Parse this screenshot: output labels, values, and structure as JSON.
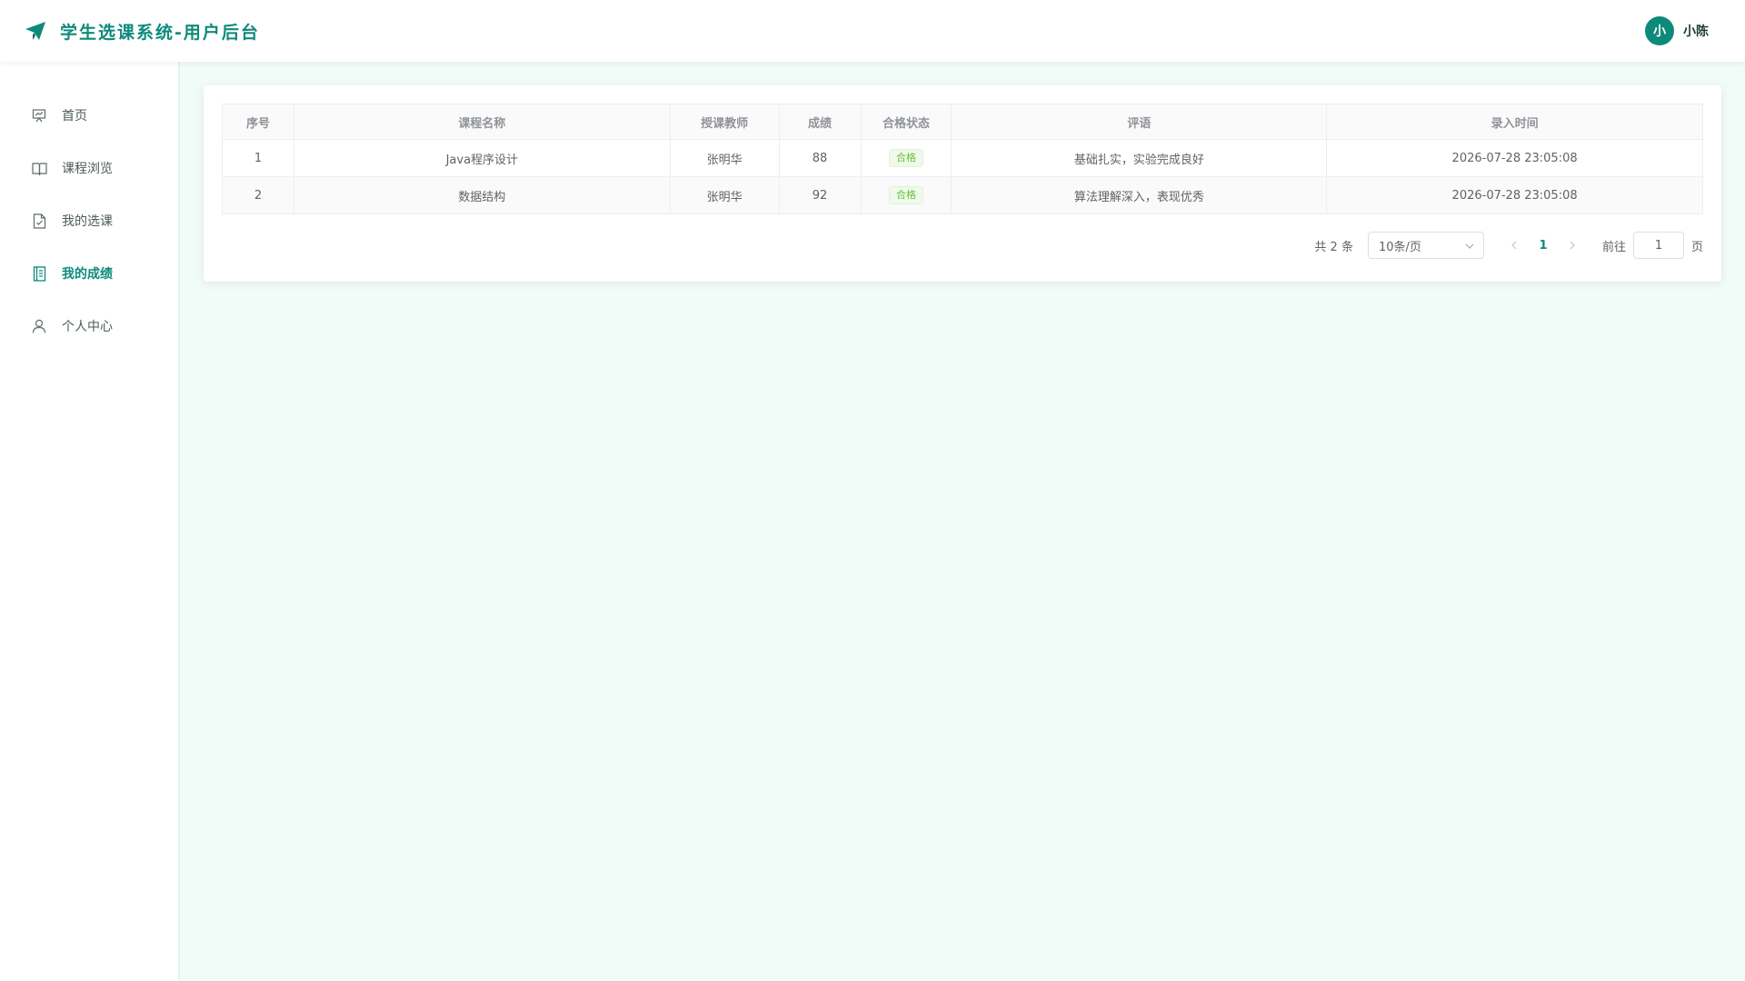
{
  "header": {
    "title": "学生选课系统-用户后台",
    "logo_icon": "paper-plane-icon",
    "user": {
      "avatar_text": "小",
      "name": "小陈"
    }
  },
  "sidebar": {
    "items": [
      {
        "label": "首页",
        "icon": "presentation-board-icon",
        "active": false
      },
      {
        "label": "课程浏览",
        "icon": "open-book-icon",
        "active": false
      },
      {
        "label": "我的选课",
        "icon": "document-check-icon",
        "active": false
      },
      {
        "label": "我的成绩",
        "icon": "notebook-icon",
        "active": true
      },
      {
        "label": "个人中心",
        "icon": "user-icon",
        "active": false
      }
    ]
  },
  "table": {
    "columns": [
      "序号",
      "课程名称",
      "授课教师",
      "成绩",
      "合格状态",
      "评语",
      "录入时间"
    ],
    "rows": [
      {
        "index": "1",
        "course": "Java程序设计",
        "teacher": "张明华",
        "score": "88",
        "status": "合格",
        "comment": "基础扎实，实验完成良好",
        "time": "2026-07-28 23:05:08"
      },
      {
        "index": "2",
        "course": "数据结构",
        "teacher": "张明华",
        "score": "92",
        "status": "合格",
        "comment": "算法理解深入，表现优秀",
        "time": "2026-07-28 23:05:08"
      }
    ]
  },
  "pagination": {
    "total_text": "共 2 条",
    "page_size": "10条/页",
    "current_page": "1",
    "goto_label": "前往",
    "goto_value": "1",
    "goto_suffix": "页"
  },
  "colors": {
    "accent": "#0e8a7a",
    "background": "#f1fbf8",
    "success_tag": "#67c23a"
  }
}
